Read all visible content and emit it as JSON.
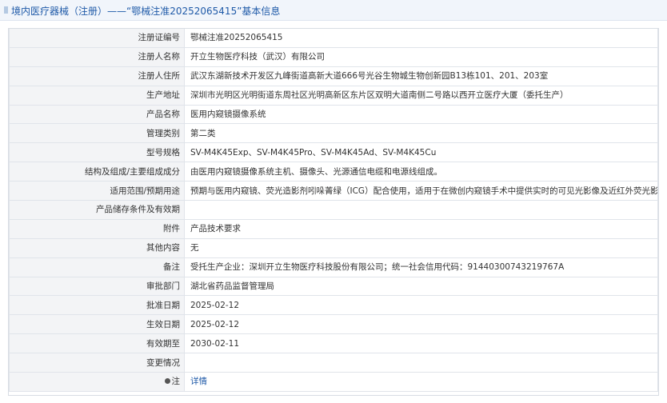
{
  "title": "境内医疗器械（注册）——“鄂械注准20252065415”基本信息",
  "rows": [
    {
      "label": "注册证编号",
      "value": "鄂械注准20252065415"
    },
    {
      "label": "注册人名称",
      "value": "开立生物医疗科技（武汉）有限公司"
    },
    {
      "label": "注册人住所",
      "value": "武汉东湖新技术开发区九峰街道高新大道666号光谷生物城生物创新园B13栋101、201、203室"
    },
    {
      "label": "生产地址",
      "value": "深圳市光明区光明街道东周社区光明高新区东片区双明大道南侧二号路以西开立医疗大厦（委托生产）"
    },
    {
      "label": "产品名称",
      "value": "医用内窥镜摄像系统"
    },
    {
      "label": "管理类别",
      "value": "第二类"
    },
    {
      "label": "型号规格",
      "value": "SV-M4K45Exp、SV-M4K45Pro、SV-M4K45Ad、SV-M4K45Cu"
    },
    {
      "label": "结构及组成/主要组成成分",
      "value": "由医用内窥镜摄像系统主机、摄像头、光源通信电缆和电源线组成。"
    },
    {
      "label": "适用范围/预期用途",
      "value": "预期与医用内窥镜、荧光造影剂吲哚菁绿（ICG）配合使用，适用于在微创内窥镜手术中提供实时的可见光影像及近红外荧光影像。"
    },
    {
      "label": "产品储存条件及有效期",
      "value": ""
    },
    {
      "label": "附件",
      "value": "产品技术要求"
    },
    {
      "label": "其他内容",
      "value": "无"
    },
    {
      "label": "备注",
      "value": "受托生产企业：深圳开立生物医疗科技股份有限公司；统一社会信用代码：91440300743219767A"
    },
    {
      "label": "审批部门",
      "value": "湖北省药品监督管理局"
    },
    {
      "label": "批准日期",
      "value": "2025-02-12"
    },
    {
      "label": "生效日期",
      "value": "2025-02-12"
    },
    {
      "label": "有效期至",
      "value": "2030-02-11"
    },
    {
      "label": "变更情况",
      "value": ""
    }
  ],
  "note_row": {
    "label": "注",
    "link_text": "详情"
  }
}
